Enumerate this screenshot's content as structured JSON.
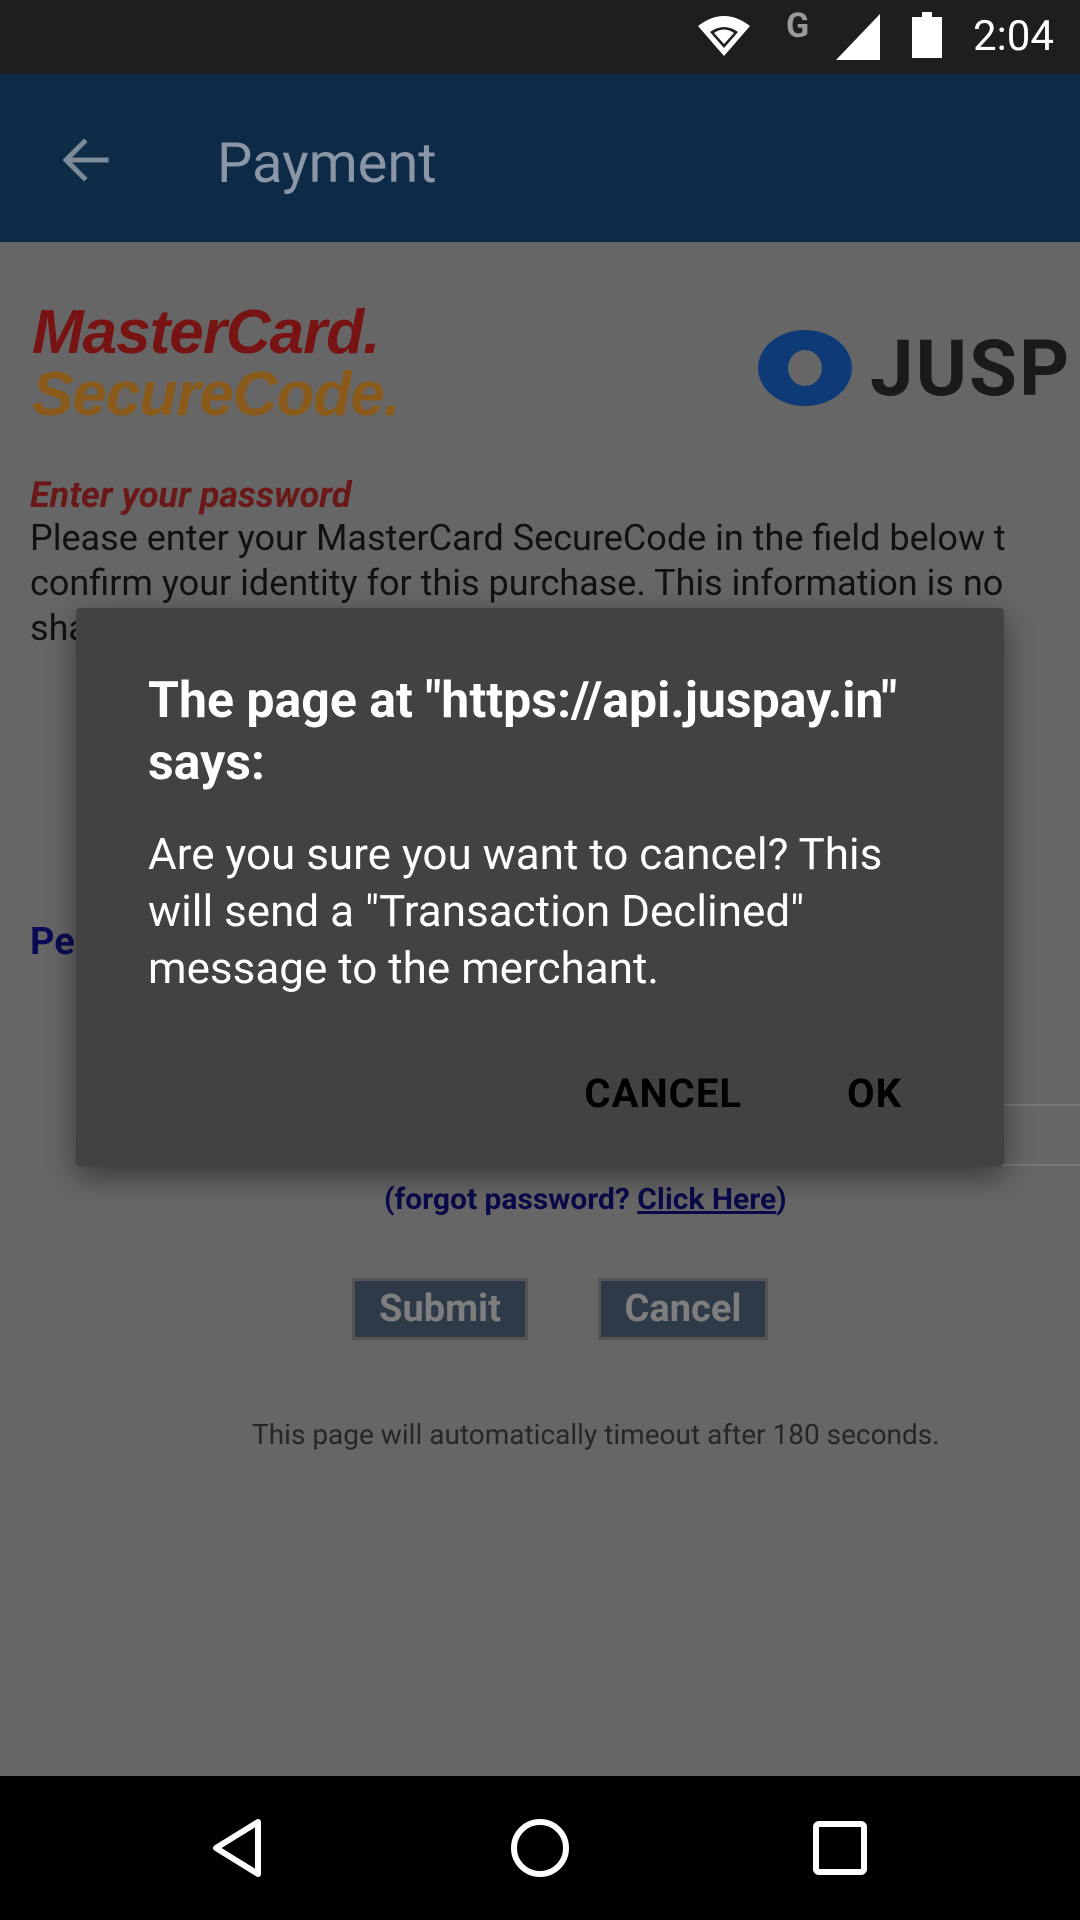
{
  "status_bar": {
    "network_label": "G",
    "time": "2:04",
    "icons": [
      "wifi-icon",
      "signal-icon",
      "battery-icon"
    ]
  },
  "app_bar": {
    "title": "Payment",
    "back_icon": "arrow-left-icon"
  },
  "web_content": {
    "logo_line1": "MasterCard.",
    "logo_line2": "SecureCode.",
    "juspay_logo": "JUSP",
    "enter_password": "Enter your password",
    "instructions": "Please enter your MasterCard SecureCode in the field below t\nconfirm your identity for this purchase. This information is no\nsha",
    "password_label_partial": "Pe",
    "forgot_prefix": "(forgot password? ",
    "forgot_link": "Click Here",
    "forgot_suffix": ")",
    "submit_label": "Submit",
    "cancel_label": "Cancel",
    "timeout_note": "This page will automatically timeout after 180 seconds."
  },
  "dialog": {
    "title": "The page at \"https://api.juspay.in\" says:",
    "message": "Are you sure you want to cancel? This will send a \"Transaction Declined\" message to the merchant.",
    "cancel_label": "CANCEL",
    "ok_label": "OK"
  },
  "nav_bar": {
    "buttons": [
      "back-triangle-icon",
      "home-circle-icon",
      "recents-square-icon"
    ]
  },
  "colors": {
    "app_bar": "#0d2a47",
    "dialog_bg": "#424242",
    "scrim_content": "#666666"
  }
}
